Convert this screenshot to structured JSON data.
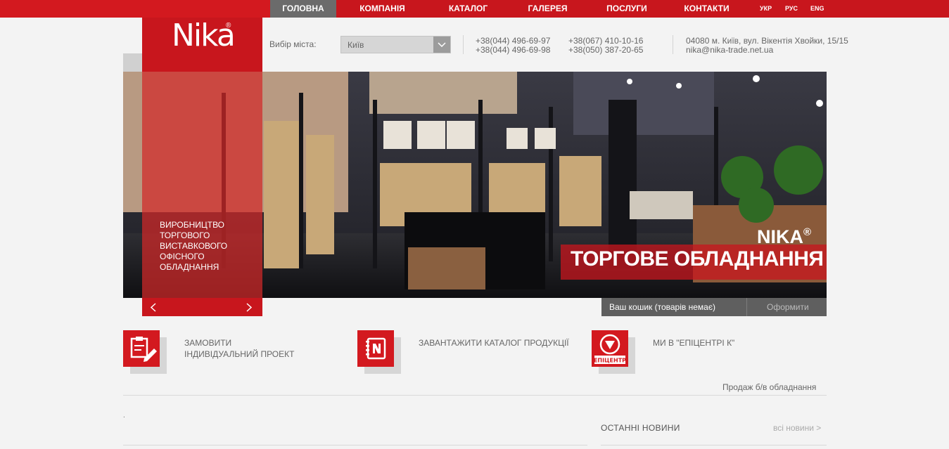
{
  "nav": {
    "items": [
      {
        "label": "ГОЛОВНА",
        "active": true
      },
      {
        "label": "КОМПАНІЯ",
        "active": false
      },
      {
        "label": "КАТАЛОГ",
        "active": false
      },
      {
        "label": "ГАЛЕРЕЯ",
        "active": false
      },
      {
        "label": "ПОСЛУГИ",
        "active": false
      },
      {
        "label": "КОНТАКТИ",
        "active": false
      }
    ],
    "languages": [
      "УКР",
      "РУС",
      "ENG"
    ]
  },
  "logo": {
    "text": "Nika",
    "reg": "®"
  },
  "city": {
    "label": "Вибір міста:",
    "value": "Київ"
  },
  "phones": {
    "col1": [
      "+38(044) 496-69-97",
      "+38(044) 496-69-98"
    ],
    "col2": [
      "+38(067) 410-10-16",
      "+38(050) 387-20-65"
    ]
  },
  "address": {
    "line1": "04080 м. Київ, вул. Вікентія Хвойки, 15/15",
    "email": "nika@nika-trade.net.ua"
  },
  "slider": {
    "caption": [
      "ВИРОБНИЦТВО",
      "ТОРГОВОГО",
      "ВИСТАВКОВОГО",
      "ОФІСНОГО",
      "ОБЛАДНАННЯ"
    ],
    "brand": "NIKA",
    "brand_reg": "®",
    "title": "ТОРГОВЕ ОБЛАДНАННЯ"
  },
  "cart": {
    "text": "Ваш кошик (товарів немає)",
    "checkout": "Оформити"
  },
  "tiles": [
    {
      "line1": "ЗАМОВИТИ",
      "line2": "ІНДИВІДУАЛЬНИЙ ПРОЕКТ",
      "icon": "clipboard-pencil-icon"
    },
    {
      "line1": "ЗАВАНТАЖИТИ КАТАЛОГ ПРОДУКЦІЇ",
      "line2": "",
      "icon": "catalog-book-icon"
    },
    {
      "line1": "МИ В \"ЕПІЦЕНТРІ К\"",
      "line2": "",
      "icon": "epicentr-logo-icon",
      "icon_text": "ЕПІЦЕНТР"
    }
  ],
  "sale_link": "Продаж б/в обладнання",
  "dot": ".",
  "news": {
    "title": "ОСТАННІ НОВИНИ",
    "all": "всі новини >"
  },
  "colors": {
    "accent": "#c8161d",
    "active_nav": "#6b6b6b",
    "background": "#f3f3f3"
  }
}
